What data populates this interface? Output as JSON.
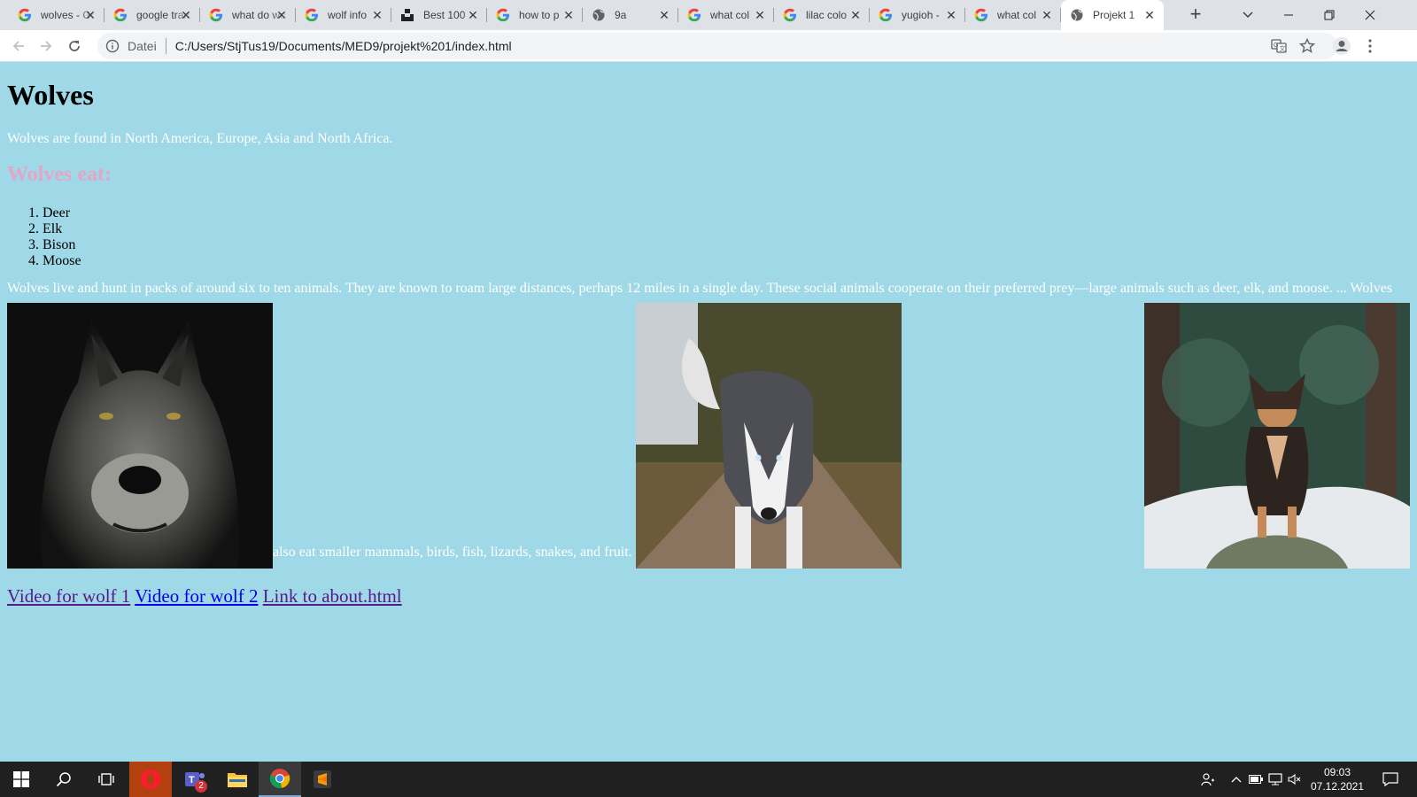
{
  "browser": {
    "tabs": [
      {
        "title": "wolves - Google-Suche",
        "favicon": "google-icon"
      },
      {
        "title": "google translate",
        "favicon": "google-icon"
      },
      {
        "title": "what do wolves eat",
        "favicon": "google-icon"
      },
      {
        "title": "wolf info",
        "favicon": "google-icon"
      },
      {
        "title": "Best 100",
        "favicon": "unsplash-icon"
      },
      {
        "title": "how to p",
        "favicon": "google-icon"
      },
      {
        "title": "9a",
        "favicon": "globe-icon"
      },
      {
        "title": "what col",
        "favicon": "google-icon"
      },
      {
        "title": "lilac colo",
        "favicon": "google-icon"
      },
      {
        "title": "yugioh -",
        "favicon": "google-icon"
      },
      {
        "title": "what col",
        "favicon": "google-icon"
      },
      {
        "title": "Projekt 1",
        "favicon": "globe-icon",
        "active": true
      }
    ],
    "address": {
      "security_label": "Datei",
      "url": "C:/Users/StjTus19/Documents/MED9/projekt%201/index.html"
    }
  },
  "page": {
    "background_color": "#9fd8e6",
    "heading": "Wolves",
    "intro": "Wolves are found in North America, Europe, Asia and North Africa.",
    "subheading": "Wolves eat:",
    "subheading_color": "#e3a6c8",
    "foods": [
      "Deer",
      "Elk",
      "Bison",
      "Moose"
    ],
    "paragraph_start": "Wolves live and hunt in packs of around six to ten animals. They are known to roam large distances, perhaps 12 miles in a single day. These social animals cooperate on their preferred prey—large animals such as deer, elk, and moose. ... Wolves",
    "paragraph_end": "also eat smaller mammals, birds, fish, lizards, snakes, and fruit.",
    "images": [
      {
        "subject": "grey wolf close-up portrait on dark background"
      },
      {
        "subject": "husky walking on forest path"
      },
      {
        "subject": "dog standing on snowy rock in forest"
      }
    ],
    "links": [
      {
        "label": "Video for wolf 1",
        "visited": true
      },
      {
        "label": "Video for wolf 2",
        "visited": false
      },
      {
        "label": "Link to about.html",
        "visited": true
      }
    ]
  },
  "taskbar": {
    "pinned": [
      "windows-start-icon",
      "search-icon",
      "task-view-icon",
      "opera-icon",
      "teams-icon",
      "file-explorer-icon",
      "chrome-icon",
      "sublime-text-icon"
    ],
    "teams_badge": "2",
    "time": "09:03",
    "date": "07.12.2021"
  }
}
